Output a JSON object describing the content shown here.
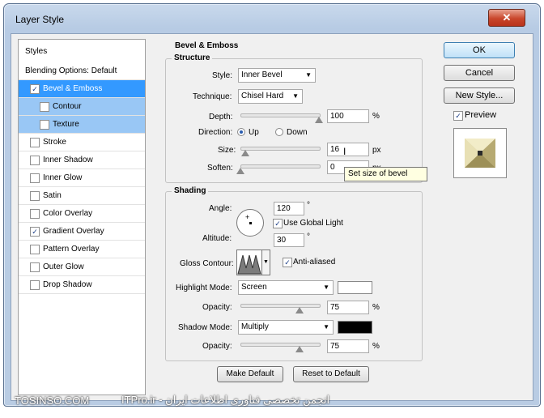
{
  "window": {
    "title": "Layer Style",
    "close_glyph": "✕"
  },
  "styles_list": {
    "header": "Styles",
    "items": [
      {
        "label": "Blending Options: Default",
        "checkbox": false,
        "checked": false,
        "state": "normal"
      },
      {
        "label": "Bevel & Emboss",
        "checkbox": true,
        "checked": true,
        "state": "selected"
      },
      {
        "label": "Contour",
        "checkbox": true,
        "checked": false,
        "state": "sub"
      },
      {
        "label": "Texture",
        "checkbox": true,
        "checked": false,
        "state": "sub"
      },
      {
        "label": "Stroke",
        "checkbox": true,
        "checked": false,
        "state": "normal"
      },
      {
        "label": "Inner Shadow",
        "checkbox": true,
        "checked": false,
        "state": "normal"
      },
      {
        "label": "Inner Glow",
        "checkbox": true,
        "checked": false,
        "state": "normal"
      },
      {
        "label": "Satin",
        "checkbox": true,
        "checked": false,
        "state": "normal"
      },
      {
        "label": "Color Overlay",
        "checkbox": true,
        "checked": false,
        "state": "normal"
      },
      {
        "label": "Gradient Overlay",
        "checkbox": true,
        "checked": true,
        "state": "normal"
      },
      {
        "label": "Pattern Overlay",
        "checkbox": true,
        "checked": false,
        "state": "normal"
      },
      {
        "label": "Outer Glow",
        "checkbox": true,
        "checked": false,
        "state": "normal"
      },
      {
        "label": "Drop Shadow",
        "checkbox": true,
        "checked": false,
        "state": "normal"
      }
    ]
  },
  "bevel": {
    "title": "Bevel & Emboss",
    "structure_title": "Structure",
    "style_label": "Style:",
    "style_value": "Inner Bevel",
    "technique_label": "Technique:",
    "technique_value": "Chisel Hard",
    "depth_label": "Depth:",
    "depth_value": "100",
    "depth_unit": "%",
    "depth_fraction": 1.0,
    "direction_label": "Direction:",
    "direction_up": "Up",
    "direction_down": "Down",
    "direction_selected": "Up",
    "size_label": "Size:",
    "size_value": "16",
    "size_unit": "px",
    "size_fraction": 0.06,
    "soften_label": "Soften:",
    "soften_value": "0",
    "soften_unit": "px",
    "soften_fraction": 0.0,
    "tooltip": "Set size of bevel"
  },
  "shading": {
    "title": "Shading",
    "angle_label": "Angle:",
    "angle_value": "120",
    "angle_unit": "°",
    "global_light_label": "Use Global Light",
    "global_light_checked": true,
    "altitude_label": "Altitude:",
    "altitude_value": "30",
    "altitude_unit": "°",
    "gloss_contour_label": "Gloss Contour:",
    "anti_aliased_label": "Anti-aliased",
    "anti_aliased_checked": true,
    "highlight_mode_label": "Highlight Mode:",
    "highlight_mode_value": "Screen",
    "highlight_color": "#ffffff",
    "highlight_opacity_label": "Opacity:",
    "highlight_opacity_value": "75",
    "highlight_opacity_unit": "%",
    "highlight_opacity_fraction": 0.75,
    "shadow_mode_label": "Shadow Mode:",
    "shadow_mode_value": "Multiply",
    "shadow_color": "#000000",
    "shadow_opacity_label": "Opacity:",
    "shadow_opacity_value": "75",
    "shadow_opacity_unit": "%",
    "shadow_opacity_fraction": 0.75
  },
  "footer": {
    "make_default": "Make Default",
    "reset_default": "Reset to Default"
  },
  "actions": {
    "ok": "OK",
    "cancel": "Cancel",
    "new_style": "New Style...",
    "preview_label": "Preview",
    "preview_checked": true
  },
  "watermark": {
    "left": "TOSINSO.COM",
    "right": "ITPro.ir - انجمن تخصصی فناوری اطلاعات ایران"
  }
}
